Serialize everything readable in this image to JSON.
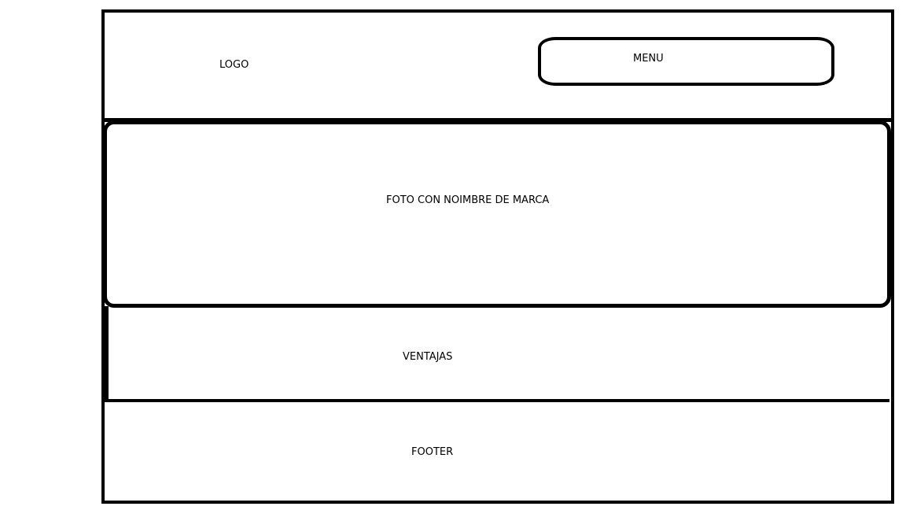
{
  "header": {
    "logo_label": "LOGO",
    "menu_label": "MENU"
  },
  "hero": {
    "label": "FOTO CON NOIMBRE DE MARCA"
  },
  "ventajas": {
    "label": "VENTAJAS"
  },
  "footer": {
    "label": "FOOTER"
  },
  "colors": {
    "stroke": "#000000",
    "background": "#ffffff"
  }
}
